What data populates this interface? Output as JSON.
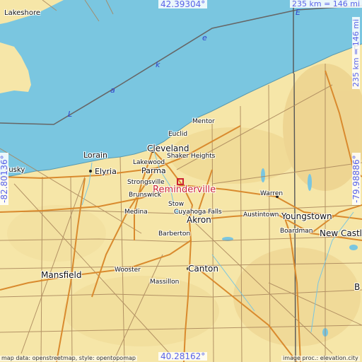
{
  "target": {
    "name": "Reminderville",
    "marker_color": "#cc2233"
  },
  "coordinates": {
    "north": "42.39304°",
    "south": "40.28162°",
    "west": "-82.80136°",
    "east": "-79.98886°",
    "scale": "235 km = 146 mi"
  },
  "lake": {
    "letters": [
      "L",
      "a",
      "k",
      "e",
      "E"
    ]
  },
  "places": {
    "lakeshore": "Lakeshore",
    "sandusky": "dusky",
    "mentor": "Mentor",
    "euclid": "Euclid",
    "cleveland": "Cleveland",
    "shaker_heights": "Shaker Heights",
    "lorain": "Lorain",
    "lakewood": "Lakewood",
    "elyria": "Elyria",
    "parma": "Parma",
    "strongsville": "Strongsville",
    "brunswick": "Brunswick",
    "stow": "Stow",
    "warren": "Warren",
    "cuyahoga_falls": "Cuyahoga Falls",
    "austintown": "Austintown",
    "youngstown": "Youngstown",
    "medina": "Medina",
    "akron": "Akron",
    "boardman": "Boardman",
    "new_castle": "New Castle",
    "barberton": "Barberton",
    "wooster": "Wooster",
    "canton": "Canton",
    "mansfield": "Mansfield",
    "massillon": "Massillon",
    "erie_edge": "E",
    "pa_edge": "E",
    "b_edge": "B"
  },
  "credits": {
    "left": "map data: openstreetmap, style: opentopomap",
    "right": "image proc.: elevation.city"
  },
  "colors": {
    "water": "#7ac6e0",
    "land": "#f6e6a8",
    "primary_road": "#d98a2e",
    "secondary_road": "#a8845a",
    "coord_text": "#5a64e8",
    "border": "#555555"
  }
}
